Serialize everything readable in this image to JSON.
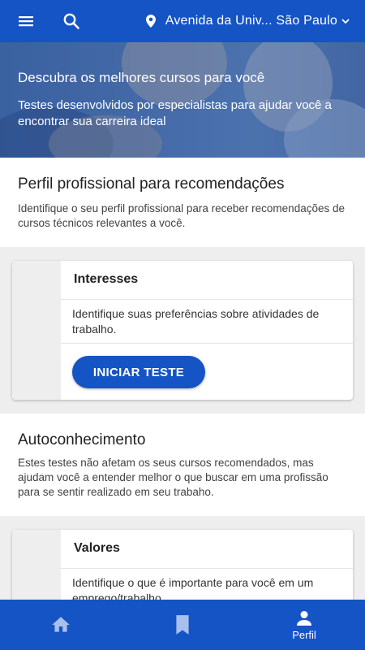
{
  "appbar": {
    "location_text": "Avenida da Univ... São Paulo",
    "icons": [
      "menu-icon",
      "search-icon",
      "location-pin-icon",
      "chevron-down-icon"
    ]
  },
  "hero": {
    "title": "Descubra os melhores cursos para você",
    "subtitle": "Testes desenvolvidos por especialistas para ajudar você a encontrar sua carreira ideal"
  },
  "profile_section": {
    "title": "Perfil profissional para recomendações",
    "description": "Identifique o seu perfil profissional para receber recomendações de cursos técnicos relevantes a você."
  },
  "interests_card": {
    "title": "Interesses",
    "description": "Identifique suas preferências sobre atividades de trabalho.",
    "button_label": "INICIAR TESTE"
  },
  "selfknowledge_section": {
    "title": "Autoconhecimento",
    "description": "Estes testes não afetam os seus cursos recomendados, mas ajudam você a entender melhor o que buscar em uma profissão para se sentir realizado em seu trabaho."
  },
  "values_card": {
    "title": "Valores",
    "description": "Identifique o que é importante para você em um emprego/trabalho."
  },
  "bottom_nav": {
    "items": [
      {
        "icon": "home-icon",
        "label": ""
      },
      {
        "icon": "bookmark-icon",
        "label": ""
      },
      {
        "icon": "person-icon",
        "label": "Perfil"
      }
    ],
    "active_index": 2
  },
  "colors": {
    "primary": "#1454c4",
    "background": "#eeeeee"
  }
}
